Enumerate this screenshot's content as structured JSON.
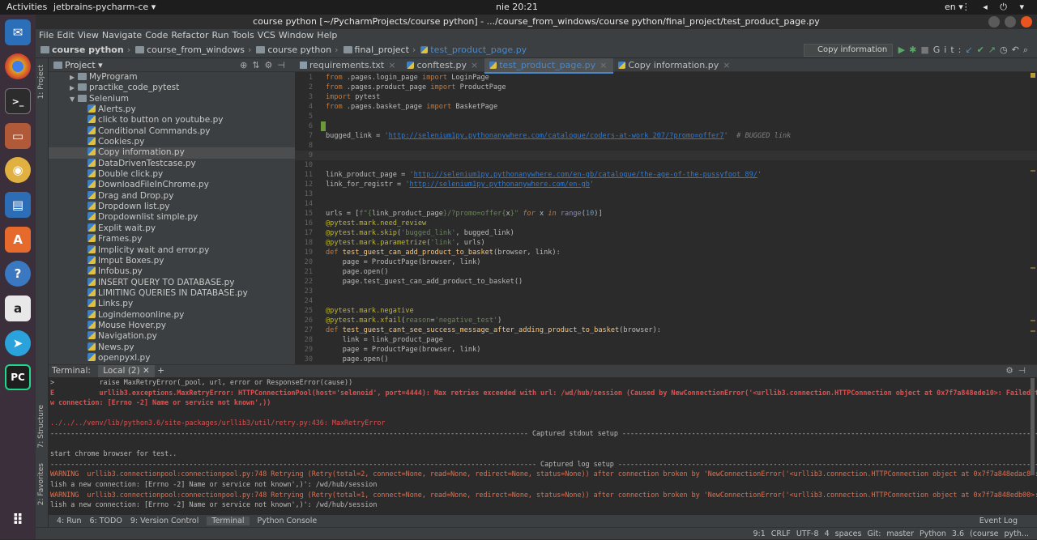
{
  "topbar": {
    "activities": "Activities",
    "app_name": "jetbrains-pycharm-ce",
    "clock": "nie 20:21",
    "lang": "en"
  },
  "window": {
    "title": "course python [~/PycharmProjects/course python] - .../course_from_windows/course python/final_project/test_product_page.py"
  },
  "menu": [
    "File",
    "Edit",
    "View",
    "Navigate",
    "Code",
    "Refactor",
    "Run",
    "Tools",
    "VCS",
    "Window",
    "Help"
  ],
  "breadcrumb": [
    "course python",
    "course_from_windows",
    "course python",
    "final_project",
    "test_product_page.py"
  ],
  "run_config": "Copy information",
  "git_label": "Git:",
  "left_strip": {
    "project": "1: Project",
    "structure": "7: Structure",
    "favorites": "2: Favorites"
  },
  "project_panel": {
    "header": "Project",
    "items": [
      {
        "label": "MyProgram",
        "kind": "dir",
        "expanded": false,
        "indent": 2
      },
      {
        "label": "practike_code_pytest",
        "kind": "dir",
        "expanded": false,
        "indent": 2
      },
      {
        "label": "Selenium",
        "kind": "dir",
        "expanded": true,
        "indent": 2
      },
      {
        "label": "Alerts.py",
        "kind": "file",
        "indent": 3
      },
      {
        "label": "click to button on youtube.py",
        "kind": "file",
        "indent": 3
      },
      {
        "label": "Conditional Commands.py",
        "kind": "file",
        "indent": 3
      },
      {
        "label": "Cookies.py",
        "kind": "file",
        "indent": 3
      },
      {
        "label": "Copy information.py",
        "kind": "file",
        "indent": 3,
        "selected": true
      },
      {
        "label": "DataDrivenTestcase.py",
        "kind": "file",
        "indent": 3
      },
      {
        "label": "Double click.py",
        "kind": "file",
        "indent": 3
      },
      {
        "label": "DownloadFileInChrome.py",
        "kind": "file",
        "indent": 3
      },
      {
        "label": "Drag and Drop.py",
        "kind": "file",
        "indent": 3
      },
      {
        "label": "Dropdown list.py",
        "kind": "file",
        "indent": 3
      },
      {
        "label": "Dropdownlist simple.py",
        "kind": "file",
        "indent": 3
      },
      {
        "label": "Explit wait.py",
        "kind": "file",
        "indent": 3
      },
      {
        "label": "Frames.py",
        "kind": "file",
        "indent": 3
      },
      {
        "label": "Implicity wait and error.py",
        "kind": "file",
        "indent": 3
      },
      {
        "label": "Imput Boxes.py",
        "kind": "file",
        "indent": 3
      },
      {
        "label": "Infobus.py",
        "kind": "file",
        "indent": 3
      },
      {
        "label": "INSERT QUERY TO DATABASE.py",
        "kind": "file",
        "indent": 3
      },
      {
        "label": "LIMITING QUERIES IN DATABASE.py",
        "kind": "file",
        "indent": 3
      },
      {
        "label": "Links.py",
        "kind": "file",
        "indent": 3
      },
      {
        "label": "Logindemoonline.py",
        "kind": "file",
        "indent": 3
      },
      {
        "label": "Mouse Hover.py",
        "kind": "file",
        "indent": 3
      },
      {
        "label": "Navigation.py",
        "kind": "file",
        "indent": 3
      },
      {
        "label": "News.py",
        "kind": "file",
        "indent": 3
      },
      {
        "label": "openpyxl.py",
        "kind": "file",
        "indent": 3
      }
    ]
  },
  "tabs": [
    {
      "label": "requirements.txt",
      "icon": "txt",
      "active": false
    },
    {
      "label": "conftest.py",
      "icon": "py",
      "active": false
    },
    {
      "label": "test_product_page.py",
      "icon": "py",
      "active": true
    },
    {
      "label": "Copy information.py",
      "icon": "py",
      "active": false
    }
  ],
  "code_lines": [
    "1|<span class=\"kw2\">from</span> .pages.login_page <span class=\"kw2\">import</span> LoginPage",
    "2|<span class=\"kw2\">from</span> .pages.product_page <span class=\"kw2\">import</span> ProductPage",
    "3|<span class=\"kw2\">import</span> pytest",
    "4|<span class=\"kw2\">from</span> .pages.basket_page <span class=\"kw2\">import</span> BasketPage",
    "5|",
    "6|",
    "7|bugged_link = <span class=\"str\">'<span class=\"url\">http://selenium1py.pythonanywhere.com/catalogue/coders-at-work_207/?promo=offer7</span>'</span>  <span class=\"cmt\"># BUGGED link</span>",
    "8|",
    "9|",
    "10|",
    "11|link_product_page = <span class=\"str\">'<span class=\"url\">http://selenium1py.pythonanywhere.com/en-gb/catalogue/the-age-of-the-pussyfoot_89/</span>'</span>",
    "12|link_for_registr = <span class=\"str\">'<span class=\"url\">http://selenium1py.pythonanywhere.com/en-gb</span>'</span>",
    "13|",
    "14|",
    "15|urls = [<span class=\"str\">f\"{</span>link_product_page<span class=\"str\">}/?promo=offer{</span>x<span class=\"str\">}\"</span> <span class=\"kw\">for</span> x <span class=\"kw\">in</span> <span class=\"bi\">range</span>(<span class=\"num\">10</span>)]",
    "16|<span class=\"dec\">@pytest.mark.need_review</span>",
    "17|<span class=\"dec\">@pytest.mark.skip</span>(<span class=\"str\">'bugged_link'</span>, bugged_link)",
    "18|<span class=\"dec\">@pytest.mark.parametrize</span>(<span class=\"str\">'link'</span>, urls)",
    "19|<span class=\"kw2\">def</span> <span class=\"fn\">test_guest_can_add_product_to_basket</span>(browser, link):",
    "20|    page = ProductPage(browser, link)",
    "21|    page.open()",
    "22|    page.test_guest_can_add_product_to_basket()",
    "23|",
    "24|",
    "25|<span class=\"dec\">@pytest.mark.negative</span>",
    "26|<span class=\"dec\">@pytest.mark.xfail</span>(<span class=\"str\">reason</span>=<span class=\"str\">'negative_test'</span>)",
    "27|<span class=\"kw2\">def</span> <span class=\"fn\">test_guest_cant_see_success_message_after_adding_product_to_basket</span>(browser):",
    "28|    link = link_product_page",
    "29|    page = ProductPage(browser, link)",
    "30|    page.open()"
  ],
  "terminal": {
    "label": "Terminal:",
    "tab": "Local (2)",
    "lines": [
      {
        "t": ">           raise MaxRetryError(_pool, url, error or ResponseError(cause))",
        "c": ""
      },
      {
        "t": "E           urllib3.exceptions.MaxRetryError: HTTPConnectionPool(host='selenoid', port=4444): Max retries exceeded with url: /wd/hub/session (Caused by NewConnectionError('<urllib3.connection.HTTPConnection object at 0x7f7a848ede10>: Failed to establish a ne",
        "c": "red"
      },
      {
        "t": "w connection: [Errno -2] Name or service not known',))",
        "c": "red"
      },
      {
        "t": "",
        "c": ""
      },
      {
        "t": "../../../venv/lib/python3.6/site-packages/urllib3/util/retry.py:436: MaxRetryError",
        "c": "path"
      },
      {
        "t": "--------------------------------------------------------------------------------------------------------------------- Captured stdout setup -------------------------------------------------------------------------------------------------------------------",
        "c": ""
      },
      {
        "t": "",
        "c": ""
      },
      {
        "t": "start chrome browser for test..",
        "c": ""
      },
      {
        "t": "----------------------------------------------------------------------------------------------------------------------- Captured log setup --------------------------------------------------------------------------------------------------------------------",
        "c": ""
      },
      {
        "t": "WARNING  urllib3.connectionpool:connectionpool.py:748 Retrying (Retry(total=2, connect=None, read=None, redirect=None, status=None)) after connection broken by 'NewConnectionError('<urllib3.connection.HTTPConnection object at 0x7f7a848edac8>: Failed to estab",
        "c": "warn"
      },
      {
        "t": "lish a new connection: [Errno -2] Name or service not known',)': /wd/hub/session",
        "c": ""
      },
      {
        "t": "WARNING  urllib3.connectionpool:connectionpool.py:748 Retrying (Retry(total=1, connect=None, read=None, redirect=None, status=None)) after connection broken by 'NewConnectionError('<urllib3.connection.HTTPConnection object at 0x7f7a848edb00>: Failed to estab",
        "c": "warn"
      },
      {
        "t": "lish a new connection: [Errno -2] Name or service not known',)': /wd/hub/session",
        "c": ""
      }
    ]
  },
  "toolwindows": [
    "4: Run",
    "6: TODO",
    "9: Version Control",
    "Terminal",
    "Python Console"
  ],
  "event_log": "Event Log",
  "status": {
    "position": "9:1",
    "line_sep": "CRLF",
    "encoding": "UTF-8",
    "indent": "4 spaces",
    "git": "Git: master",
    "interpreter": "Python 3.6 (course pyth..."
  }
}
